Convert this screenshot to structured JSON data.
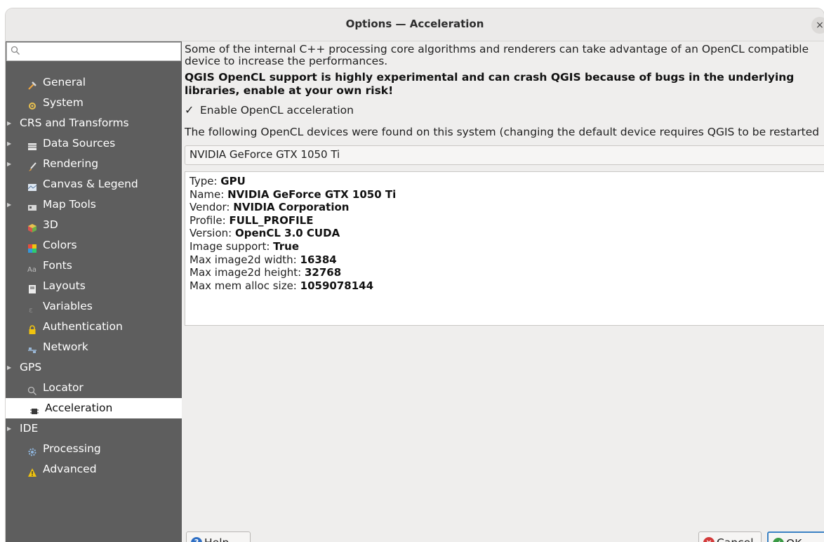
{
  "window": {
    "title": "Options — Acceleration",
    "close_glyph": "×"
  },
  "sidebar": {
    "search": {
      "placeholder": ""
    },
    "items": [
      {
        "label": "General",
        "icon": "hammer-icon",
        "expandable": false,
        "selected": false
      },
      {
        "label": "System",
        "icon": "gear-icon",
        "expandable": false,
        "selected": false
      },
      {
        "label": "CRS and Transforms",
        "icon": "",
        "expandable": true,
        "selected": false
      },
      {
        "label": "Data Sources",
        "icon": "table-icon",
        "expandable": true,
        "selected": false
      },
      {
        "label": "Rendering",
        "icon": "brush-icon",
        "expandable": true,
        "selected": false
      },
      {
        "label": "Canvas & Legend",
        "icon": "map-icon",
        "expandable": false,
        "selected": false
      },
      {
        "label": "Map Tools",
        "icon": "map-tools-icon",
        "expandable": true,
        "selected": false
      },
      {
        "label": "3D",
        "icon": "cube-icon",
        "expandable": false,
        "selected": false
      },
      {
        "label": "Colors",
        "icon": "palette-icon",
        "expandable": false,
        "selected": false
      },
      {
        "label": "Fonts",
        "icon": "font-icon",
        "expandable": false,
        "selected": false
      },
      {
        "label": "Layouts",
        "icon": "layout-icon",
        "expandable": false,
        "selected": false
      },
      {
        "label": "Variables",
        "icon": "variables-icon",
        "expandable": false,
        "selected": false
      },
      {
        "label": "Authentication",
        "icon": "lock-icon",
        "expandable": false,
        "selected": false
      },
      {
        "label": "Network",
        "icon": "network-icon",
        "expandable": false,
        "selected": false
      },
      {
        "label": "GPS",
        "icon": "",
        "expandable": true,
        "selected": false
      },
      {
        "label": "Locator",
        "icon": "search-icon",
        "expandable": false,
        "selected": false
      },
      {
        "label": "Acceleration",
        "icon": "chip-icon",
        "expandable": false,
        "selected": true
      },
      {
        "label": "IDE",
        "icon": "",
        "expandable": true,
        "selected": false
      },
      {
        "label": "Processing",
        "icon": "processing-gear-icon",
        "expandable": false,
        "selected": false
      },
      {
        "label": "Advanced",
        "icon": "warning-icon",
        "expandable": false,
        "selected": false
      }
    ]
  },
  "main": {
    "intro": "Some of the internal C++ processing core algorithms and renderers can take advantage of an OpenCL compatible device to increase the performances.",
    "warning": "QGIS OpenCL support is highly experimental and can crash QGIS because of bugs in the underlying libraries, enable at your own risk!",
    "enable_checkbox": {
      "label": "Enable OpenCL acceleration",
      "checked": true,
      "glyph": "✓"
    },
    "devices_text": "The following OpenCL devices were found on this system (changing the default device requires QGIS to be restarted",
    "device_combo": {
      "value": "NVIDIA GeForce GTX 1050 Ti"
    },
    "device_info": [
      {
        "key": "Type:",
        "value": "GPU"
      },
      {
        "key": "Name:",
        "value": "NVIDIA GeForce GTX 1050 Ti"
      },
      {
        "key": "Vendor:",
        "value": "NVIDIA Corporation"
      },
      {
        "key": "Profile:",
        "value": "FULL_PROFILE"
      },
      {
        "key": "Version:",
        "value": "OpenCL 3.0 CUDA"
      },
      {
        "key": "Image support:",
        "value": "True"
      },
      {
        "key": "Max image2d width:",
        "value": "16384"
      },
      {
        "key": "Max image2d height:",
        "value": "32768"
      },
      {
        "key": "Max mem alloc size:",
        "value": "1059078144"
      }
    ]
  },
  "buttons": {
    "help": "Help",
    "cancel_first": "C",
    "cancel_rest": "ancel",
    "ok_first": "O",
    "ok_rest": "K",
    "help_icon": "?",
    "cancel_icon": "×",
    "ok_icon": "✓"
  },
  "colors": {
    "sidebar_bg": "#5e5e5e",
    "selected_bg": "#ffffff",
    "help_blue": "#2f6fc4",
    "cancel_red": "#d33a3a",
    "ok_green": "#3a9a44"
  }
}
